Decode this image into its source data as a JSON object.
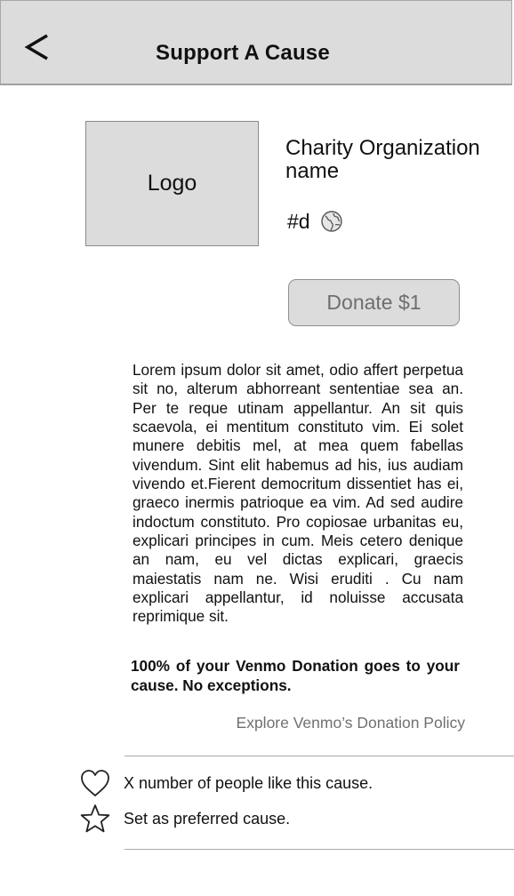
{
  "header": {
    "title": "Support A Cause",
    "back_icon": "chevron-left-icon"
  },
  "organization": {
    "logo_label": "Logo",
    "name": "Charity Organization name",
    "handle": "#d",
    "website_icon": "globe-icon"
  },
  "donate": {
    "label": "Donate $1"
  },
  "description": "Lorem ipsum dolor sit amet, odio affert perpetua sit no, alterum abhorreant sententiae sea an. Per te reque utinam appellantur. An sit quis scaevola, ei mentitum constituto vim. Ei solet munere debitis mel, at mea quem fabellas vivendum. Sint elit habemus ad his, ius audiam vivendo et.Fierent democritum dissentiet has ei, graeco inermis patrioque ea vim. Ad sed audire indoctum constituto. Pro copiosae urbanitas eu, explicari principes in cum. Meis cetero denique an nam, eu vel dictas explicari, graecis maiestatis nam ne. Wisi eruditi . Cu nam explicari appellantur, id noluisse accusata reprimique sit.",
  "guarantee": "100% of your Venmo Donation goes to your cause. No exceptions.",
  "policy_link": "Explore Venmo’s Donation Policy",
  "actions": {
    "like_label": "X number of people like this cause.",
    "like_icon": "heart-icon",
    "preferred_label": "Set as preferred cause.",
    "preferred_icon": "star-icon"
  },
  "colors": {
    "header_bg": "#dcdcdc",
    "placeholder_bg": "#dcdcdc",
    "muted_text": "#707070"
  }
}
